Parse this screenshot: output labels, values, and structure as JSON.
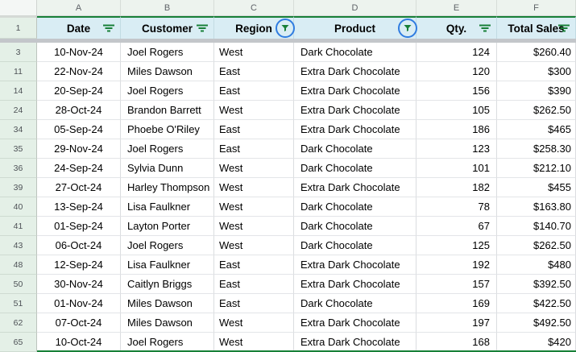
{
  "columns": {
    "letters": [
      "A",
      "B",
      "C",
      "D",
      "E",
      "F"
    ]
  },
  "header": {
    "row_number": "1",
    "cells": [
      {
        "label": "Date",
        "filter": "lines"
      },
      {
        "label": "Customer",
        "filter": "lines"
      },
      {
        "label": "Region",
        "filter": "active"
      },
      {
        "label": "Product",
        "filter": "active"
      },
      {
        "label": "Qty.",
        "filter": "lines"
      },
      {
        "label": "Total Sales",
        "filter": "lines"
      }
    ]
  },
  "rows": [
    {
      "row_number": "3",
      "date": "10-Nov-24",
      "customer": "Joel Rogers",
      "region": "West",
      "product": "Dark Chocolate",
      "qty": "124",
      "total": "$260.40"
    },
    {
      "row_number": "11",
      "date": "22-Nov-24",
      "customer": "Miles Dawson",
      "region": "East",
      "product": "Extra Dark Chocolate",
      "qty": "120",
      "total": "$300"
    },
    {
      "row_number": "14",
      "date": "20-Sep-24",
      "customer": "Joel Rogers",
      "region": "East",
      "product": "Extra Dark Chocolate",
      "qty": "156",
      "total": "$390"
    },
    {
      "row_number": "24",
      "date": "28-Oct-24",
      "customer": "Brandon Barrett",
      "region": "West",
      "product": "Extra Dark Chocolate",
      "qty": "105",
      "total": "$262.50"
    },
    {
      "row_number": "34",
      "date": "05-Sep-24",
      "customer": "Phoebe O'Riley",
      "region": "East",
      "product": "Extra Dark Chocolate",
      "qty": "186",
      "total": "$465"
    },
    {
      "row_number": "35",
      "date": "29-Nov-24",
      "customer": "Joel Rogers",
      "region": "East",
      "product": "Dark Chocolate",
      "qty": "123",
      "total": "$258.30"
    },
    {
      "row_number": "36",
      "date": "24-Sep-24",
      "customer": "Sylvia Dunn",
      "region": "West",
      "product": "Dark Chocolate",
      "qty": "101",
      "total": "$212.10"
    },
    {
      "row_number": "39",
      "date": "27-Oct-24",
      "customer": "Harley Thompson",
      "region": "West",
      "product": "Extra Dark Chocolate",
      "qty": "182",
      "total": "$455"
    },
    {
      "row_number": "40",
      "date": "13-Sep-24",
      "customer": "Lisa Faulkner",
      "region": "West",
      "product": "Dark Chocolate",
      "qty": "78",
      "total": "$163.80"
    },
    {
      "row_number": "41",
      "date": "01-Sep-24",
      "customer": "Layton Porter",
      "region": "West",
      "product": "Dark Chocolate",
      "qty": "67",
      "total": "$140.70"
    },
    {
      "row_number": "43",
      "date": "06-Oct-24",
      "customer": "Joel Rogers",
      "region": "West",
      "product": "Dark Chocolate",
      "qty": "125",
      "total": "$262.50"
    },
    {
      "row_number": "48",
      "date": "12-Sep-24",
      "customer": "Lisa Faulkner",
      "region": "East",
      "product": "Extra Dark Chocolate",
      "qty": "192",
      "total": "$480"
    },
    {
      "row_number": "50",
      "date": "30-Nov-24",
      "customer": "Caitlyn Briggs",
      "region": "East",
      "product": "Extra Dark Chocolate",
      "qty": "157",
      "total": "$392.50"
    },
    {
      "row_number": "51",
      "date": "01-Nov-24",
      "customer": "Miles Dawson",
      "region": "East",
      "product": "Dark Chocolate",
      "qty": "169",
      "total": "$422.50"
    },
    {
      "row_number": "62",
      "date": "07-Oct-24",
      "customer": "Miles Dawson",
      "region": "West",
      "product": "Extra Dark Chocolate",
      "qty": "197",
      "total": "$492.50"
    },
    {
      "row_number": "65",
      "date": "10-Oct-24",
      "customer": "Joel Rogers",
      "region": "West",
      "product": "Extra Dark Chocolate",
      "qty": "168",
      "total": "$420"
    }
  ],
  "colors": {
    "filter_range_border": "#188038",
    "filter_icon_green": "#188038",
    "active_filter_circle_blue": "#2f7ce0",
    "header_fill": "#d9edf4",
    "row_header_fill": "#e4f0e7",
    "column_strip_fill": "#edf3ee",
    "hidden_rows_band": "#c3c6ca"
  }
}
